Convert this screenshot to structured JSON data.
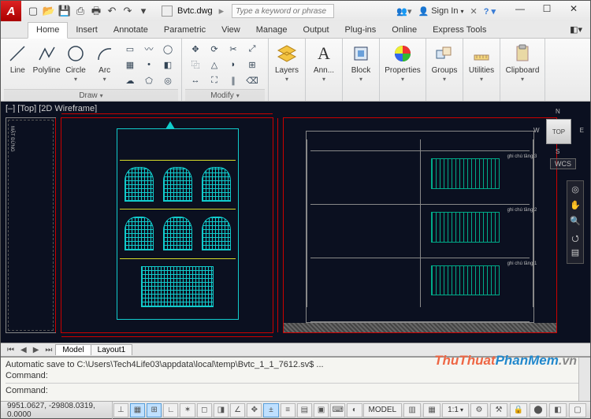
{
  "title": {
    "filename": "Bvtc.dwg"
  },
  "search": {
    "placeholder": "Type a keyword or phrase"
  },
  "signin": {
    "label": "Sign In"
  },
  "ribbon_tabs": [
    "Home",
    "Insert",
    "Annotate",
    "Parametric",
    "View",
    "Manage",
    "Output",
    "Plug-ins",
    "Online",
    "Express Tools"
  ],
  "active_tab": "Home",
  "panels": {
    "draw": {
      "title": "Draw",
      "big": [
        {
          "name": "line",
          "label": "Line"
        },
        {
          "name": "polyline",
          "label": "Polyline"
        },
        {
          "name": "circle",
          "label": "Circle"
        },
        {
          "name": "arc",
          "label": "Arc"
        }
      ]
    },
    "modify": {
      "title": "Modify"
    },
    "layers": {
      "title": "Layers",
      "label": "Layers"
    },
    "annotation": {
      "title": "Ann...",
      "label": "Ann...",
      "letter": "A"
    },
    "block": {
      "title": "Block",
      "label": "Block"
    },
    "properties": {
      "title": "Properties",
      "label": "Properties"
    },
    "groups": {
      "title": "Groups",
      "label": "Groups"
    },
    "utilities": {
      "title": "Utilities",
      "label": "Utilities"
    },
    "clipboard": {
      "title": "Clipboard",
      "label": "Clipboard"
    }
  },
  "view": {
    "label": "[–] [Top] [2D Wireframe]"
  },
  "viewcube": {
    "face": "TOP",
    "n": "N",
    "s": "S",
    "e": "E",
    "w": "W"
  },
  "wcs": "WCS",
  "model_tabs": {
    "items": [
      "Model",
      "Layout1"
    ],
    "active": "Model"
  },
  "command": {
    "line1": "Automatic save to C:\\Users\\Tech4Life03\\appdata\\local\\temp\\Bvtc_1_1_7612.sv$ ...",
    "line2": "Command:",
    "prompt": "Command:"
  },
  "status": {
    "coords": "9951.0627, -29808.0319, 0.0000",
    "model_btn": "MODEL",
    "scale": "1:1",
    "anno": "1:1"
  },
  "watermark": {
    "a": "ThuThuat",
    "b": "PhanMem",
    "c": ".vn"
  }
}
